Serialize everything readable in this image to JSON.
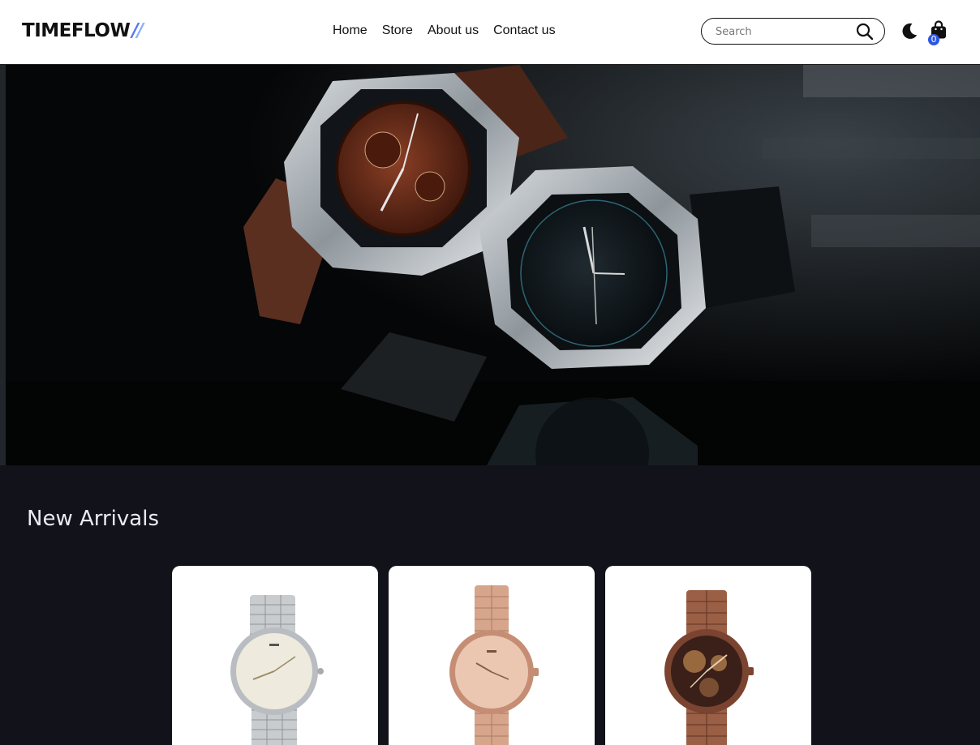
{
  "header": {
    "logo_text": "TIMEFLOW",
    "logo_mark": "//",
    "nav": [
      {
        "label": "Home"
      },
      {
        "label": "Store"
      },
      {
        "label": "About us"
      },
      {
        "label": "Contact us"
      }
    ],
    "search": {
      "placeholder": "Search",
      "icon": "search-icon"
    },
    "theme_toggle_icon": "moon-icon",
    "cart": {
      "icon": "shopping-bag-icon",
      "count": "0"
    }
  },
  "hero": {
    "image": "two luxury watches on reflective black surface"
  },
  "arrivals": {
    "title": "New Arrivals",
    "products": [
      {
        "image": "silver-watch"
      },
      {
        "image": "rose-gold-watch"
      },
      {
        "image": "bronze-skeleton-watch"
      }
    ]
  },
  "colors": {
    "brand_blue": "#4f7cf0",
    "badge_blue": "#2d56e6",
    "section_bg": "#12121a"
  }
}
